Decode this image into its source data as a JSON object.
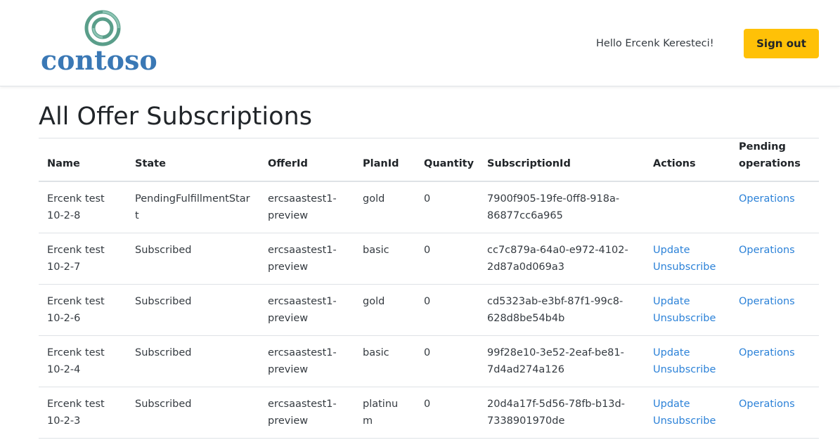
{
  "header": {
    "logo_text": "contoso",
    "greeting": "Hello Ercenk Keresteci!",
    "signout_label": "Sign out"
  },
  "page": {
    "title": "All Offer Subscriptions"
  },
  "table": {
    "columns": {
      "name": "Name",
      "state": "State",
      "offer_id": "OfferId",
      "plan_id": "PlanId",
      "quantity": "Quantity",
      "subscription_id": "SubscriptionId",
      "actions": "Actions",
      "pending_operations": "Pending operations"
    },
    "rows": [
      {
        "name": "Ercenk test 10-2-8",
        "state": "PendingFulfillmentStart",
        "offer_id": "ercsaastest1-preview",
        "plan_id": "gold",
        "quantity": "0",
        "subscription_id": "7900f905-19fe-0ff8-918a-86877cc6a965",
        "update_label": "",
        "unsubscribe_label": "",
        "operations_label": "Operations"
      },
      {
        "name": "Ercenk test 10-2-7",
        "state": "Subscribed",
        "offer_id": "ercsaastest1-preview",
        "plan_id": "basic",
        "quantity": "0",
        "subscription_id": "cc7c879a-64a0-e972-4102-2d87a0d069a3",
        "update_label": "Update",
        "unsubscribe_label": "Unsubscribe",
        "operations_label": "Operations"
      },
      {
        "name": "Ercenk test 10-2-6",
        "state": "Subscribed",
        "offer_id": "ercsaastest1-preview",
        "plan_id": "gold",
        "quantity": "0",
        "subscription_id": "cd5323ab-e3bf-87f1-99c8-628d8be54b4b",
        "update_label": "Update",
        "unsubscribe_label": "Unsubscribe",
        "operations_label": "Operations"
      },
      {
        "name": "Ercenk test 10-2-4",
        "state": "Subscribed",
        "offer_id": "ercsaastest1-preview",
        "plan_id": "basic",
        "quantity": "0",
        "subscription_id": "99f28e10-3e52-2eaf-be81-7d4ad274a126",
        "update_label": "Update",
        "unsubscribe_label": "Unsubscribe",
        "operations_label": "Operations"
      },
      {
        "name": "Ercenk test 10-2-3",
        "state": "Subscribed",
        "offer_id": "ercsaastest1-preview",
        "plan_id": "platinum",
        "quantity": "0",
        "subscription_id": "20d4a17f-5d56-78fb-b13d-7338901970de",
        "update_label": "Update",
        "unsubscribe_label": "Unsubscribe",
        "operations_label": "Operations"
      }
    ]
  },
  "colors": {
    "brand_blue": "#3a78b5",
    "logo_green": "#5a9e8a",
    "signout_yellow": "#ffc107",
    "link_blue": "#2c82d8"
  }
}
